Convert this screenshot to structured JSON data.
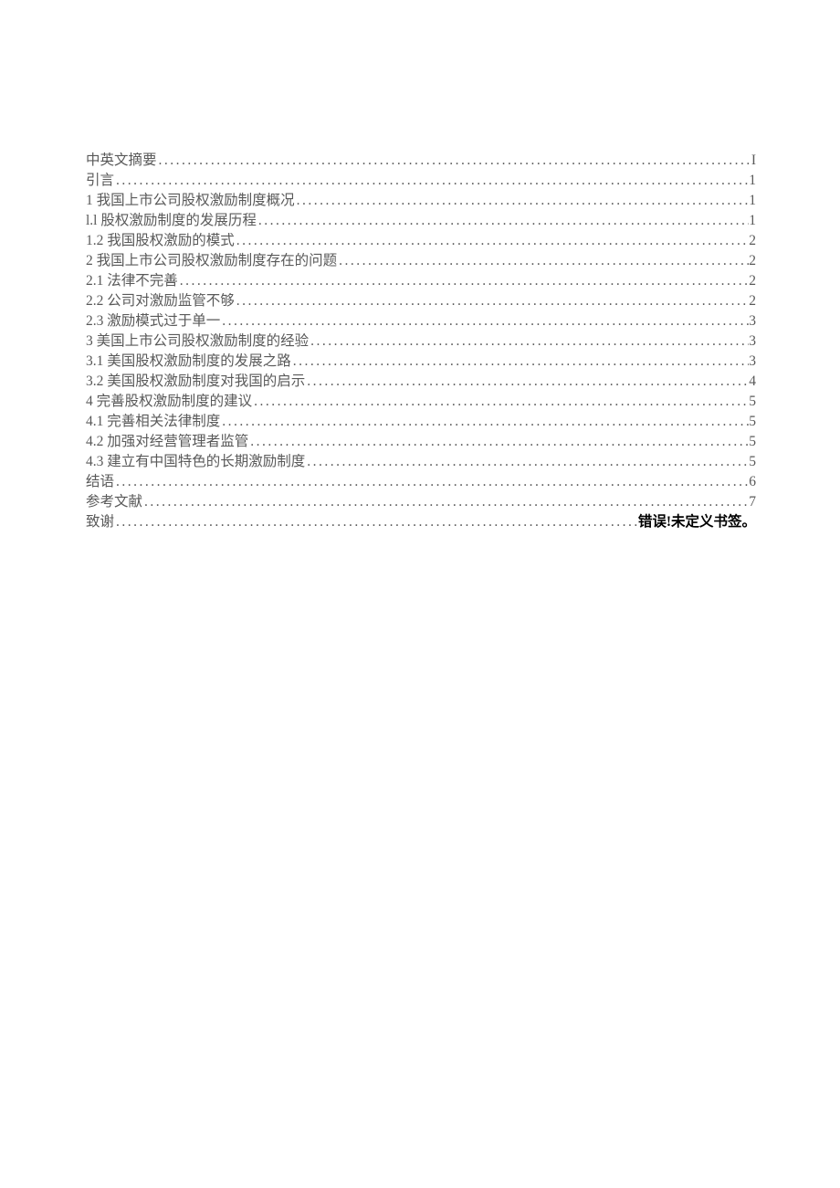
{
  "toc": {
    "entries": [
      {
        "label": "中英文摘要",
        "page": "I",
        "error": false
      },
      {
        "label": "引言",
        "page": "1",
        "error": false
      },
      {
        "label": "1 我国上市公司股权激励制度概况",
        "page": "1",
        "error": false
      },
      {
        "label": "l.l 股权激励制度的发展历程",
        "page": "1",
        "error": false
      },
      {
        "label": "1.2 我国股权激励的模式",
        "page": "2",
        "error": false
      },
      {
        "label": "2 我国上市公司股权激励制度存在的问题",
        "page": "2",
        "error": false
      },
      {
        "label": "2.1   法律不完善",
        "page": "2",
        "error": false
      },
      {
        "label": "2.2   公司对激励监管不够",
        "page": "2",
        "error": false
      },
      {
        "label": "2.3   激励模式过于单一",
        "page": "3",
        "error": false
      },
      {
        "label": "3 美国上市公司股权激励制度的经验",
        "page": "3",
        "error": false
      },
      {
        "label": "3.1   美国股权激励制度的发展之路",
        "page": "3",
        "error": false
      },
      {
        "label": "3.2   美国股权激励制度对我国的启示",
        "page": "4",
        "error": false
      },
      {
        "label": "4 完善股权激励制度的建议",
        "page": "5",
        "error": false
      },
      {
        "label": "4.1   完善相关法律制度",
        "page": "5",
        "error": false
      },
      {
        "label": "4.2   加强对经营管理者监管",
        "page": "5",
        "error": false
      },
      {
        "label": "4.3   建立有中国特色的长期激励制度",
        "page": "5",
        "error": false
      },
      {
        "label": "结语",
        "page": "6",
        "error": false
      },
      {
        "label": "参考文献",
        "page": "7",
        "error": false
      },
      {
        "label": "致谢",
        "page": "错误!未定义书签。",
        "error": true
      }
    ]
  }
}
